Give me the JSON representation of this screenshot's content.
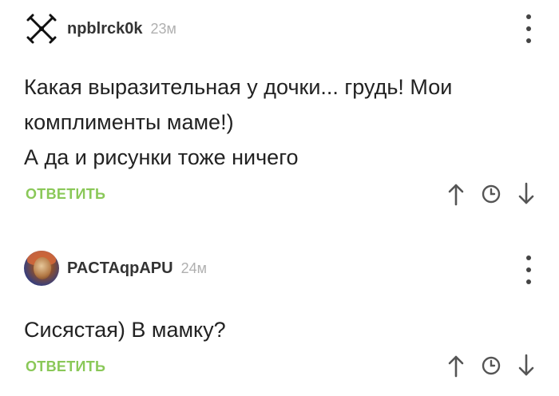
{
  "comments": [
    {
      "username": "npblrck0k",
      "time": "23м",
      "lines": [
        "Какая выразительная у дочки... грудь! Мои",
        "комплименты маме!)",
        "А да и рисунки тоже ничего"
      ],
      "reply_label": "ОТВЕТИТЬ",
      "avatar_icon": "crossed-figure-icon"
    },
    {
      "username": "PACTAqpAPU",
      "time": "24м",
      "lines": [
        "Сисястая) В мамку?"
      ],
      "reply_label": "ОТВЕТИТЬ",
      "avatar_icon": "profile-photo"
    }
  ],
  "icons": {
    "menu": "more-vertical-icon",
    "upvote": "arrow-up-icon",
    "save": "clock-icon",
    "downvote": "arrow-down-icon"
  },
  "colors": {
    "reply": "#8ac858",
    "time": "#b0b0b0",
    "icon": "#555555",
    "text": "#222222"
  }
}
